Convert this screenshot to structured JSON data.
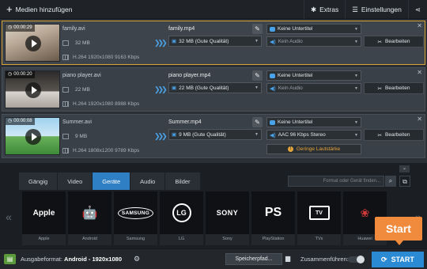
{
  "toolbar": {
    "add_media_label": "Medien hinzufügen",
    "extras_label": "Extras",
    "settings_label": "Einstellungen"
  },
  "files": [
    {
      "duration": "00:00:29",
      "source_name": "family.avi",
      "source_size": "32 MB",
      "source_codec": "H.264 1920x1080 9163 Kbps",
      "output_name": "family.mp4",
      "output_size": "32 MB (Gute Qualität)",
      "subtitle": "Keine Untertitel",
      "audio": "Kein Audio",
      "edit_label": "Bearbeiten",
      "selected": true
    },
    {
      "duration": "00:00:20",
      "source_name": "piano player.avi",
      "source_size": "22 MB",
      "source_codec": "H.264 1920x1080 8988 Kbps",
      "output_name": "piano player.mp4",
      "output_size": "22 MB (Gute Qualität)",
      "subtitle": "Keine Untertitel",
      "audio": "Kein Audio",
      "edit_label": "Bearbeiten",
      "selected": false
    },
    {
      "duration": "00:00:08",
      "source_name": "Summer.avi",
      "source_size": "9 MB",
      "source_codec": "H.264 1808x1200 9789 Kbps",
      "output_name": "Summer.mp4",
      "output_size": "9 MB (Gute Qualität)",
      "subtitle": "Keine Untertitel",
      "audio": "AAC 96 Kbps Stereo",
      "edit_label": "Bearbeiten",
      "warning": "Geringe Lautstärke",
      "selected": false
    }
  ],
  "tabs": [
    "Gängig",
    "Video",
    "Geräte",
    "Audio",
    "Bilder"
  ],
  "active_tab": "Geräte",
  "search_placeholder": "Format oder Gerät finden...",
  "devices": [
    {
      "logo": "Apple",
      "label": "Apple"
    },
    {
      "logo": "🤖",
      "label": "Android"
    },
    {
      "logo": "SAMSUNG",
      "label": "Samsung"
    },
    {
      "logo": "LG",
      "label": "LG"
    },
    {
      "logo": "SONY",
      "label": "Sony"
    },
    {
      "logo": "PS",
      "label": "PlayStation"
    },
    {
      "logo": "TV",
      "label": "TVs"
    },
    {
      "logo": "❀",
      "label": "Huawei"
    }
  ],
  "tooltip": {
    "start": "Start"
  },
  "footer": {
    "format_prefix": "Ausgabeformat:",
    "format_value": "Android - 1920x1080",
    "save_label": "Speicherpfad...",
    "merge_label": "Zusammenführen:",
    "start_label": "START"
  },
  "colors": {
    "accent": "#2a8ad4",
    "selection_border": "#d9a437",
    "warning": "#e5a43a",
    "tooltip": "#f08a3c"
  }
}
